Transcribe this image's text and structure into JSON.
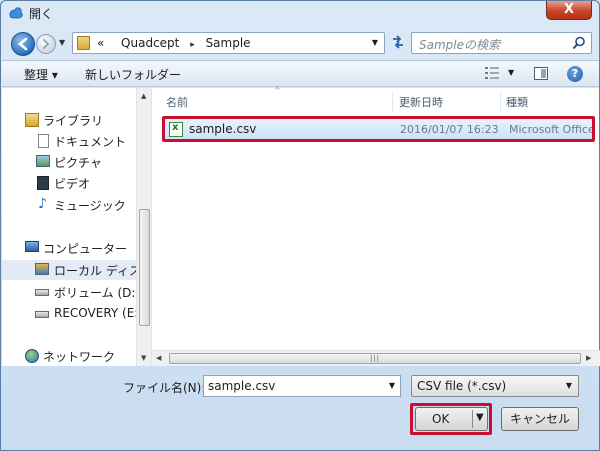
{
  "window": {
    "title": "開く",
    "close_glyph": "X"
  },
  "address": {
    "overflow": "«",
    "crumbs": [
      "Quadcept",
      "Sample"
    ],
    "separator": "▸"
  },
  "search": {
    "placeholder": "Sampleの検索"
  },
  "toolbar": {
    "organize_label": "整理 ▾",
    "new_folder_label": "新しいフォルダー"
  },
  "nav": {
    "items": [
      {
        "label": "ライブラリ",
        "icon": "library-icon"
      },
      {
        "label": "ドキュメント",
        "icon": "documents-icon"
      },
      {
        "label": "ピクチャ",
        "icon": "pictures-icon"
      },
      {
        "label": "ビデオ",
        "icon": "videos-icon"
      },
      {
        "label": "ミュージック",
        "icon": "music-icon"
      },
      {
        "label": "コンピューター",
        "icon": "computer-icon"
      },
      {
        "label": "ローカル ディス",
        "icon": "local-disk-icon"
      },
      {
        "label": "ボリューム (D:)",
        "icon": "drive-icon"
      },
      {
        "label": "RECOVERY (E:)",
        "icon": "drive-icon"
      },
      {
        "label": "ネットワーク",
        "icon": "network-icon"
      }
    ]
  },
  "columns": {
    "name": "名前",
    "modified": "更新日時",
    "type": "種類"
  },
  "files": [
    {
      "name": "sample.csv",
      "modified": "2016/01/07 16:23",
      "type": "Microsoft Office",
      "icon": "excel-csv-icon"
    }
  ],
  "bottom": {
    "filename_label": "ファイル名(N):",
    "filename_value": "sample.csv",
    "filetype_value": "CSV file (*.csv)",
    "ok_label": "OK",
    "cancel_label": "キャンセル"
  },
  "colors": {
    "highlight": "#c8102e",
    "selection": "#cde2f8"
  }
}
